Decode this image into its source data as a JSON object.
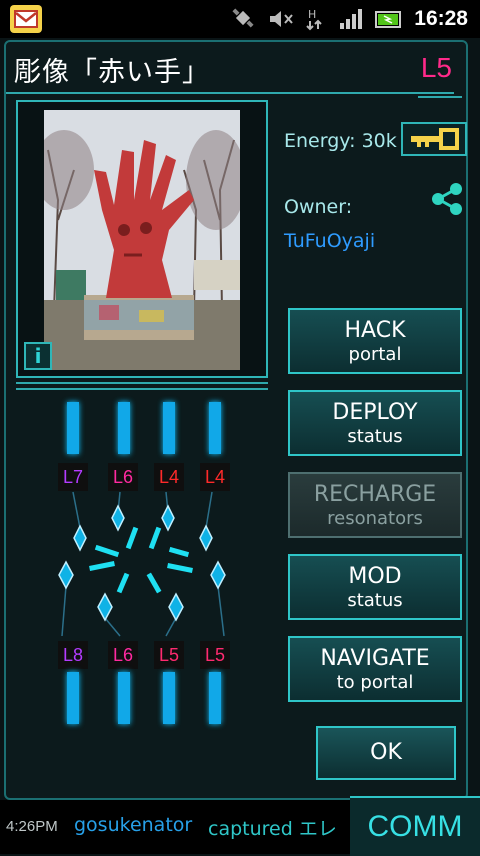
{
  "status_bar": {
    "time": "16:28",
    "icons": [
      "mail-notification-icon",
      "gps-icon",
      "mute-icon",
      "data-transfer-icon",
      "signal-icon",
      "battery-icon"
    ]
  },
  "portal": {
    "title": "彫像「赤い手」",
    "level": "L5",
    "energy_label": "Energy: 30k",
    "owner_label": "Owner:",
    "owner_name": "TuFuOyaji",
    "info_label": "i"
  },
  "actions": [
    {
      "line1": "HACK",
      "line2": "portal",
      "enabled": true
    },
    {
      "line1": "DEPLOY",
      "line2": "status",
      "enabled": true
    },
    {
      "line1": "RECHARGE",
      "line2": "resonators",
      "enabled": false
    },
    {
      "line1": "MOD",
      "line2": "status",
      "enabled": true
    },
    {
      "line1": "NAVIGATE",
      "line2": "to portal",
      "enabled": true
    }
  ],
  "ok_label": "OK",
  "resonators": {
    "top": [
      {
        "label": "L7",
        "color": "#b33cff"
      },
      {
        "label": "L6",
        "color": "#ff2aa0"
      },
      {
        "label": "L4",
        "color": "#ff2a2a"
      },
      {
        "label": "L4",
        "color": "#ff2a2a"
      }
    ],
    "bottom": [
      {
        "label": "L8",
        "color": "#b33cff"
      },
      {
        "label": "L6",
        "color": "#ff2aa0"
      },
      {
        "label": "L5",
        "color": "#ff2a70"
      },
      {
        "label": "L5",
        "color": "#ff2a70"
      }
    ]
  },
  "comm": {
    "time": "4:26PM",
    "user": "gosukenator",
    "message": "captured エレ",
    "button": "COMM"
  },
  "colors": {
    "accent": "#2fc6c8",
    "owner": "#2f9cff",
    "level": "#ff2a8a"
  }
}
